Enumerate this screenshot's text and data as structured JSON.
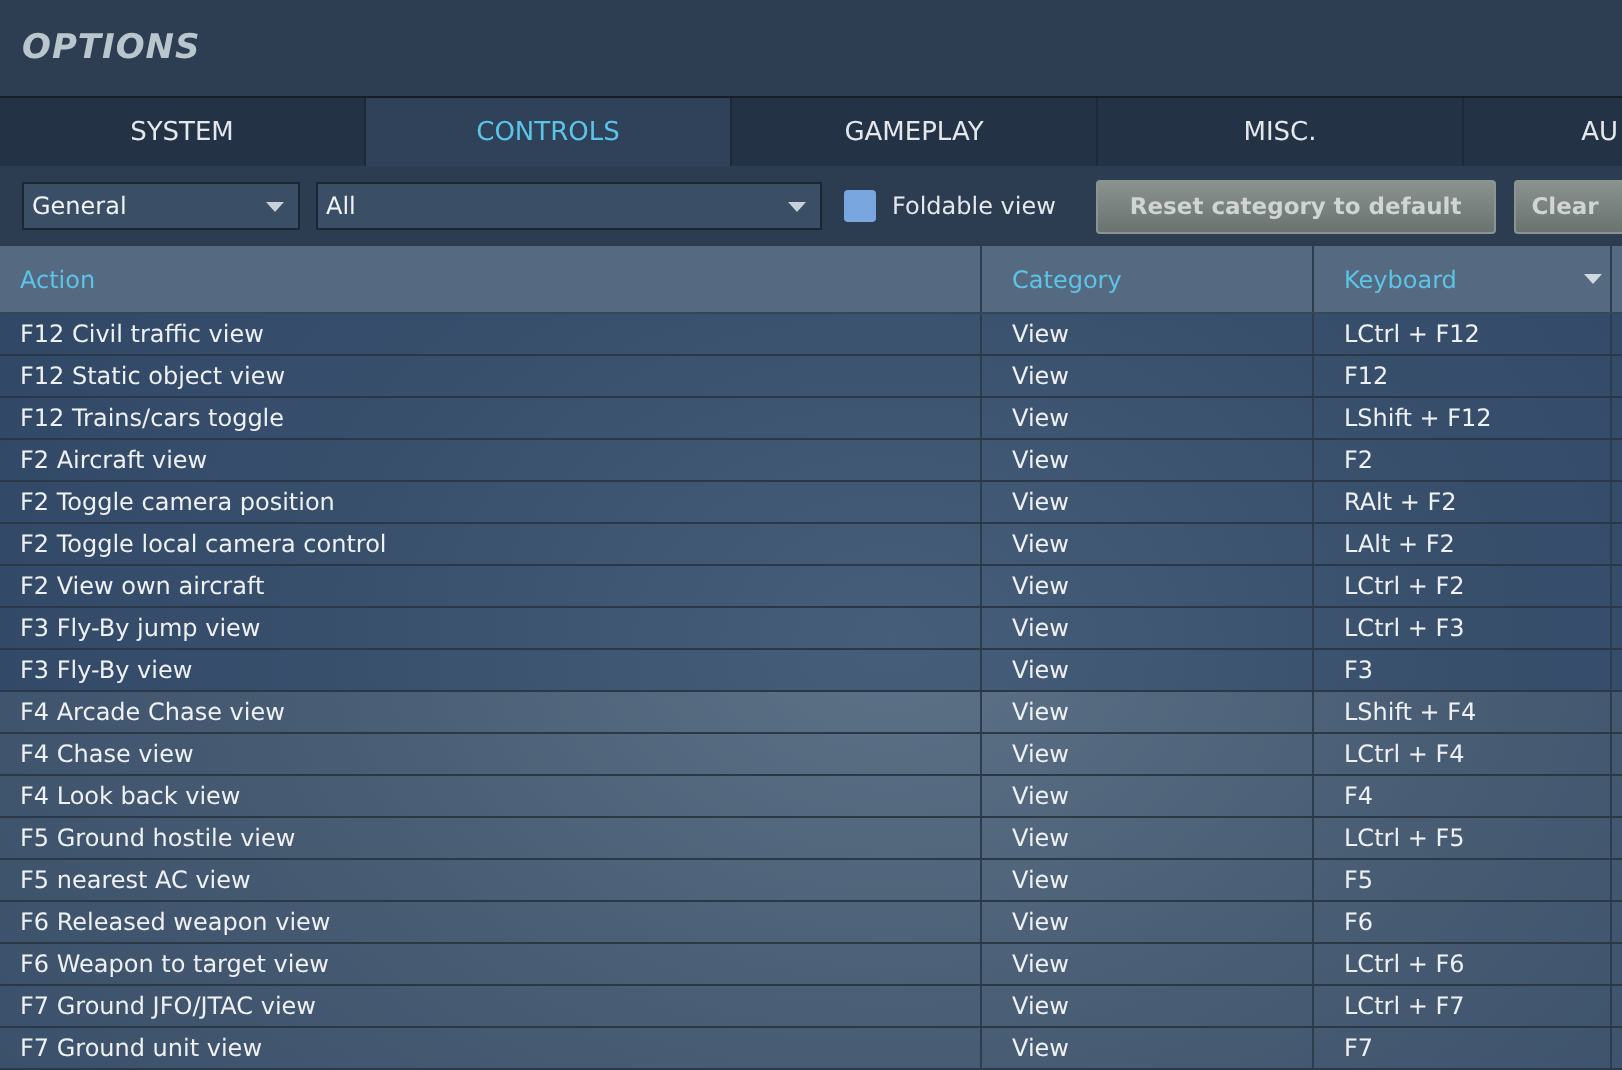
{
  "window": {
    "title": "OPTIONS"
  },
  "tabs": [
    {
      "label": "SYSTEM",
      "selected": false
    },
    {
      "label": "CONTROLS",
      "selected": true
    },
    {
      "label": "GAMEPLAY",
      "selected": false
    },
    {
      "label": "MISC.",
      "selected": false
    },
    {
      "label": "AU",
      "selected": false
    }
  ],
  "toolbar": {
    "category_dropdown": "General",
    "filter_dropdown": "All",
    "foldable_view": {
      "label": "Foldable view",
      "checked": false
    },
    "buttons": [
      "Reset category to default",
      "Clear"
    ]
  },
  "table": {
    "columns": [
      "Action",
      "Category",
      "Keyboard"
    ],
    "rows": [
      [
        "F12 Civil traffic view",
        "View",
        "LCtrl + F12"
      ],
      [
        "F12 Static object view",
        "View",
        "F12"
      ],
      [
        "F12 Trains/cars toggle",
        "View",
        "LShift + F12"
      ],
      [
        "F2 Aircraft view",
        "View",
        "F2"
      ],
      [
        "F2 Toggle camera position",
        "View",
        "RAlt + F2"
      ],
      [
        "F2 Toggle local camera control",
        "View",
        "LAlt + F2"
      ],
      [
        "F2 View own aircraft",
        "View",
        "LCtrl + F2"
      ],
      [
        "F3 Fly-By jump view",
        "View",
        "LCtrl + F3"
      ],
      [
        "F3 Fly-By view",
        "View",
        "F3"
      ],
      [
        "F4 Arcade Chase view",
        "View",
        "LShift + F4"
      ],
      [
        "F4 Chase view",
        "View",
        "LCtrl + F4"
      ],
      [
        "F4 Look back view",
        "View",
        "F4"
      ],
      [
        "F5 Ground hostile view",
        "View",
        "LCtrl + F5"
      ],
      [
        "F5 nearest AC view",
        "View",
        "F5"
      ],
      [
        "F6 Released weapon view",
        "View",
        "F6"
      ],
      [
        "F6 Weapon to target view",
        "View",
        "LCtrl + F6"
      ],
      [
        "F7 Ground JFO/JTAC view",
        "View",
        "LCtrl + F7"
      ],
      [
        "F7 Ground unit view",
        "View",
        "F7"
      ]
    ]
  }
}
